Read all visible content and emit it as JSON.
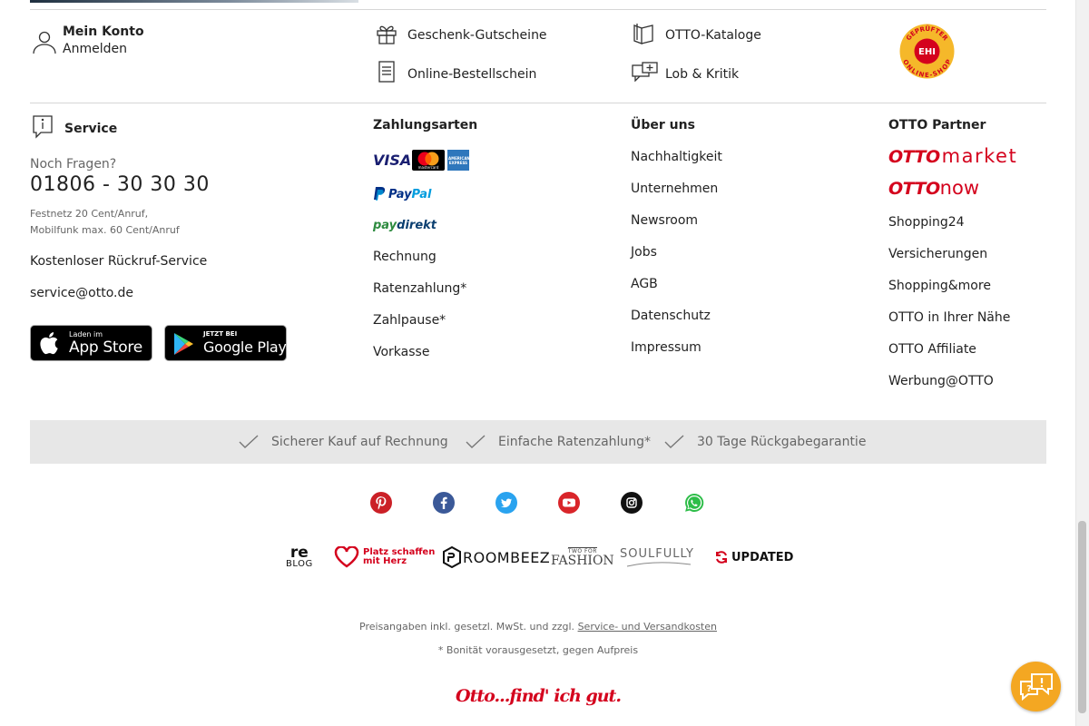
{
  "account": {
    "title": "Mein Konto",
    "login": "Anmelden"
  },
  "top_links": {
    "gift": "Geschenk-Gutscheine",
    "catalogs": "OTTO-Kataloge",
    "order_form": "Online-Bestellschein",
    "feedback": "Lob & Kritik"
  },
  "ehi_badge": {
    "arc_top": "GEPRÜFTER",
    "center": "EHI",
    "arc_bottom": "ONLINE-SHOP"
  },
  "service": {
    "title": "Service",
    "question": "Noch Fragen?",
    "phone": "01806 - 30 30 30",
    "fee_line1": "Festnetz 20 Cent/Anruf,",
    "fee_line2": "Mobilfunk max. 60 Cent/Anruf",
    "callback": "Kostenloser Rückruf-Service",
    "email": "service@otto.de",
    "app_store_small": "Laden im",
    "app_store_big": "App Store",
    "google_play_small": "JETZT BEI",
    "google_play_big": "Google Play"
  },
  "payment": {
    "title": "Zahlungsarten",
    "visa": "VISA",
    "mastercard": "mastercard",
    "amex": "AMERICAN EXPRESS",
    "paypal_pay": "Pay",
    "paypal_pal": "Pal",
    "paydirekt_pay": "pay",
    "paydirekt_direkt": "direkt",
    "links": [
      "Rechnung",
      "Ratenzahlung*",
      "Zahlpause*",
      "Vorkasse"
    ]
  },
  "about": {
    "title": "Über uns",
    "links": [
      "Nachhaltigkeit",
      "Unternehmen",
      "Newsroom",
      "Jobs",
      "AGB",
      "Datenschutz",
      "Impressum"
    ]
  },
  "partner": {
    "title": "OTTO Partner",
    "otto1": "OTTO",
    "market": "market",
    "otto2": "OTTO",
    "now": "now",
    "links": [
      "Shopping24",
      "Versicherungen",
      "Shopping&more",
      "OTTO in Ihrer Nähe",
      "OTTO Affiliate",
      "Werbung@OTTO"
    ]
  },
  "trust": [
    "Sicherer Kauf auf Rechnung",
    "Einfache Ratenzahlung*",
    "30 Tage Rückgabegarantie"
  ],
  "social": [
    "pinterest-icon",
    "facebook-icon",
    "twitter-icon",
    "youtube-icon",
    "instagram-icon",
    "whatsapp-icon"
  ],
  "brands": {
    "reblog_re": "re",
    "reblog_blog": "BLOG",
    "platz_line1": "Platz schaffen",
    "platz_line2": "mit Herz",
    "roombeez": "ROOMBEEZ",
    "twoforfashion_small": "TWO FOR",
    "twoforfashion_big": "FASHION",
    "soulfully": "SOULFULLY",
    "updated": "UPDATED"
  },
  "legal": {
    "prices_prefix": "Preisangaben inkl. gesetzl. MwSt. und zzgl.",
    "prices_link": "Service- und Versandkosten",
    "credit_note": "* Bonität vorausgesetzt, gegen Aufpreis"
  },
  "slogan": "Otto...find' ich gut.",
  "colors": {
    "otto_red": "#d4021d",
    "chat_orange": "#f4a722",
    "trust_bg": "#e7e7e7"
  }
}
